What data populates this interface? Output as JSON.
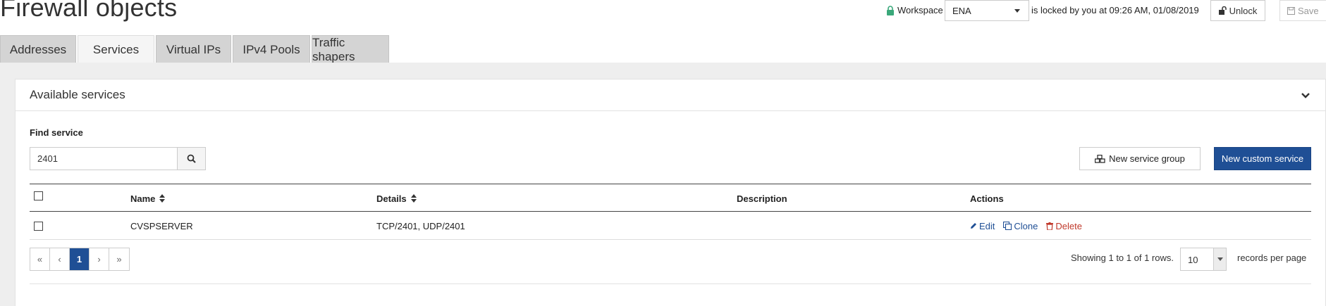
{
  "page": {
    "title": "Firewall objects"
  },
  "workspace": {
    "label": "Workspace",
    "selected": "ENA",
    "locked_text": "is locked by you at 09:26 AM, 01/08/2019",
    "unlock_label": "Unlock",
    "save_label": "Save"
  },
  "tabs": [
    {
      "label": "Addresses",
      "active": false
    },
    {
      "label": "Services",
      "active": true
    },
    {
      "label": "Virtual IPs",
      "active": false
    },
    {
      "label": "IPv4 Pools",
      "active": false
    },
    {
      "label": "Traffic shapers",
      "active": false
    }
  ],
  "panel": {
    "title": "Available services",
    "find_label": "Find service",
    "search_value": "2401",
    "new_group_label": "New service group",
    "new_custom_label": "New custom service"
  },
  "table": {
    "headers": {
      "name": "Name",
      "details": "Details",
      "description": "Description",
      "actions": "Actions"
    },
    "rows": [
      {
        "name": "CVSPSERVER",
        "details": "TCP/2401, UDP/2401",
        "description": "",
        "checked": false
      }
    ],
    "actions": {
      "edit": "Edit",
      "clone": "Clone",
      "delete": "Delete"
    }
  },
  "pagination": {
    "first": "«",
    "prev": "‹",
    "current": "1",
    "next": "›",
    "last": "»",
    "showing": "Showing 1 to 1 of 1 rows.",
    "per_page": "10",
    "per_page_label": "records per page"
  },
  "colors": {
    "primary": "#1f4f95",
    "danger": "#c0392b",
    "lock": "#3aa87a"
  },
  "icons": [
    "lock-icon",
    "unlock-icon",
    "save-icon",
    "chevron-down-icon",
    "search-icon",
    "cubes-icon",
    "pencil-icon",
    "clone-icon",
    "trash-icon"
  ]
}
